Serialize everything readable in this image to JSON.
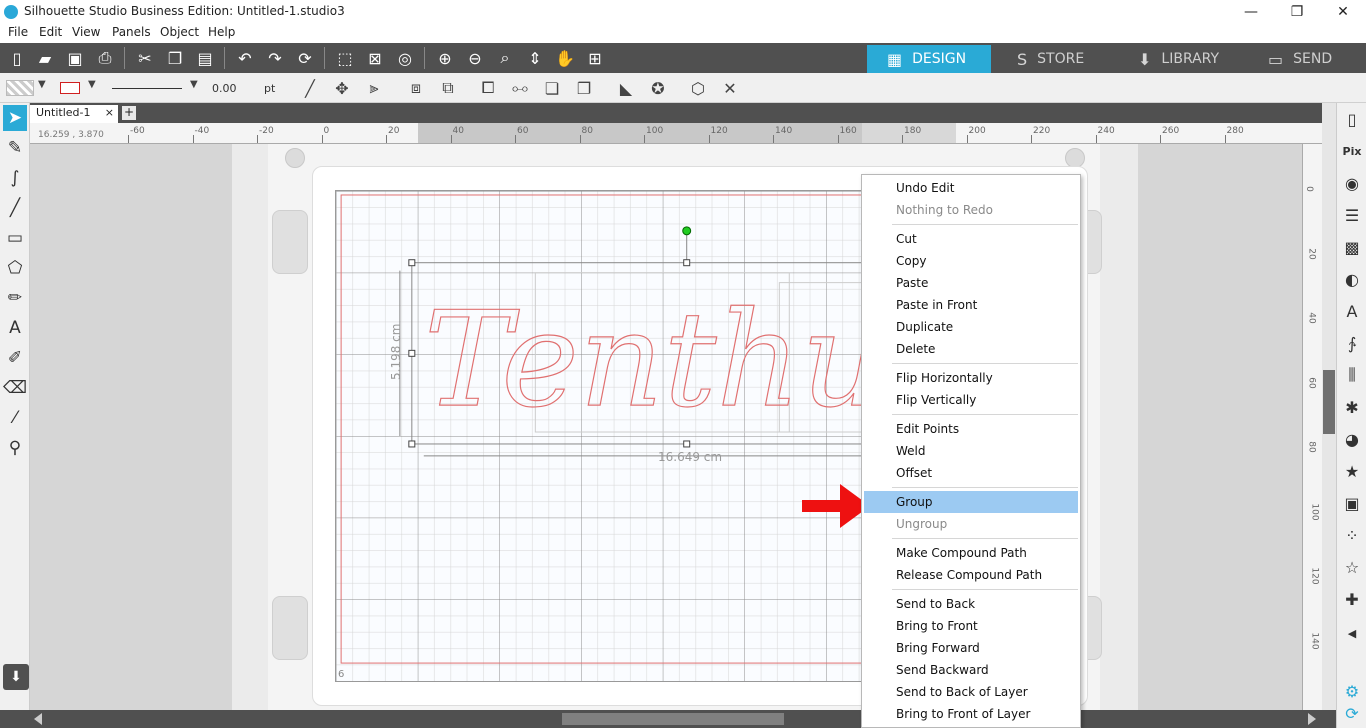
{
  "window": {
    "title": "Silhouette Studio Business Edition: Untitled-1.studio3",
    "minimize": "—",
    "maximize": "❐",
    "close": "✕"
  },
  "menu": [
    "File",
    "Edit",
    "View",
    "Panels",
    "Object",
    "Help"
  ],
  "nav_tabs": [
    {
      "label": "DESIGN",
      "icon": "▦"
    },
    {
      "label": "STORE",
      "icon": "S"
    },
    {
      "label": "LIBRARY",
      "icon": "⬇"
    },
    {
      "label": "SEND",
      "icon": "▭"
    }
  ],
  "toolbar2": {
    "line_width": "0.00",
    "unit": "pt"
  },
  "document": {
    "tab": "Untitled-1",
    "close": "×",
    "add": "+",
    "coords": "16.259 , 3.870",
    "page_number": "6"
  },
  "ruler": {
    "top_ticks": [
      "-60",
      "-40",
      "-20",
      "0",
      "20",
      "40",
      "60",
      "80",
      "100",
      "120",
      "140",
      "160",
      "180",
      "200",
      "220",
      "240",
      "260",
      "280"
    ],
    "left_ticks": [
      "0",
      "20",
      "40",
      "60",
      "80",
      "100",
      "120",
      "140"
    ]
  },
  "canvas": {
    "width_label": "16.649 cm",
    "height_label": "5.198 cm",
    "text": "Tenthundl",
    "accent": "#e8a0a0"
  },
  "context_menu": {
    "groups": [
      [
        {
          "label": "Undo Edit",
          "enabled": true
        },
        {
          "label": "Nothing to Redo",
          "enabled": false
        }
      ],
      [
        {
          "label": "Cut",
          "enabled": true
        },
        {
          "label": "Copy",
          "enabled": true
        },
        {
          "label": "Paste",
          "enabled": true
        },
        {
          "label": "Paste in Front",
          "enabled": true
        },
        {
          "label": "Duplicate",
          "enabled": true
        },
        {
          "label": "Delete",
          "enabled": true
        }
      ],
      [
        {
          "label": "Flip Horizontally",
          "enabled": true
        },
        {
          "label": "Flip Vertically",
          "enabled": true
        }
      ],
      [
        {
          "label": "Edit Points",
          "enabled": true
        },
        {
          "label": "Weld",
          "enabled": true
        },
        {
          "label": "Offset",
          "enabled": true
        }
      ],
      [
        {
          "label": "Group",
          "enabled": true,
          "highlighted": true
        },
        {
          "label": "Ungroup",
          "enabled": false
        }
      ],
      [
        {
          "label": "Make Compound Path",
          "enabled": true
        },
        {
          "label": "Release Compound Path",
          "enabled": true
        }
      ],
      [
        {
          "label": "Send to Back",
          "enabled": true
        },
        {
          "label": "Bring to Front",
          "enabled": true
        },
        {
          "label": "Bring Forward",
          "enabled": true
        },
        {
          "label": "Send Backward",
          "enabled": true
        },
        {
          "label": "Send to Back of Layer",
          "enabled": true
        },
        {
          "label": "Bring to Front of Layer",
          "enabled": true
        }
      ]
    ]
  },
  "colors": {
    "design_tab": "#2aaad6",
    "toolbar": "#505050",
    "highlight": "#9ccaf2",
    "arrow": "#ee1111",
    "cut_line": "#e07070"
  }
}
